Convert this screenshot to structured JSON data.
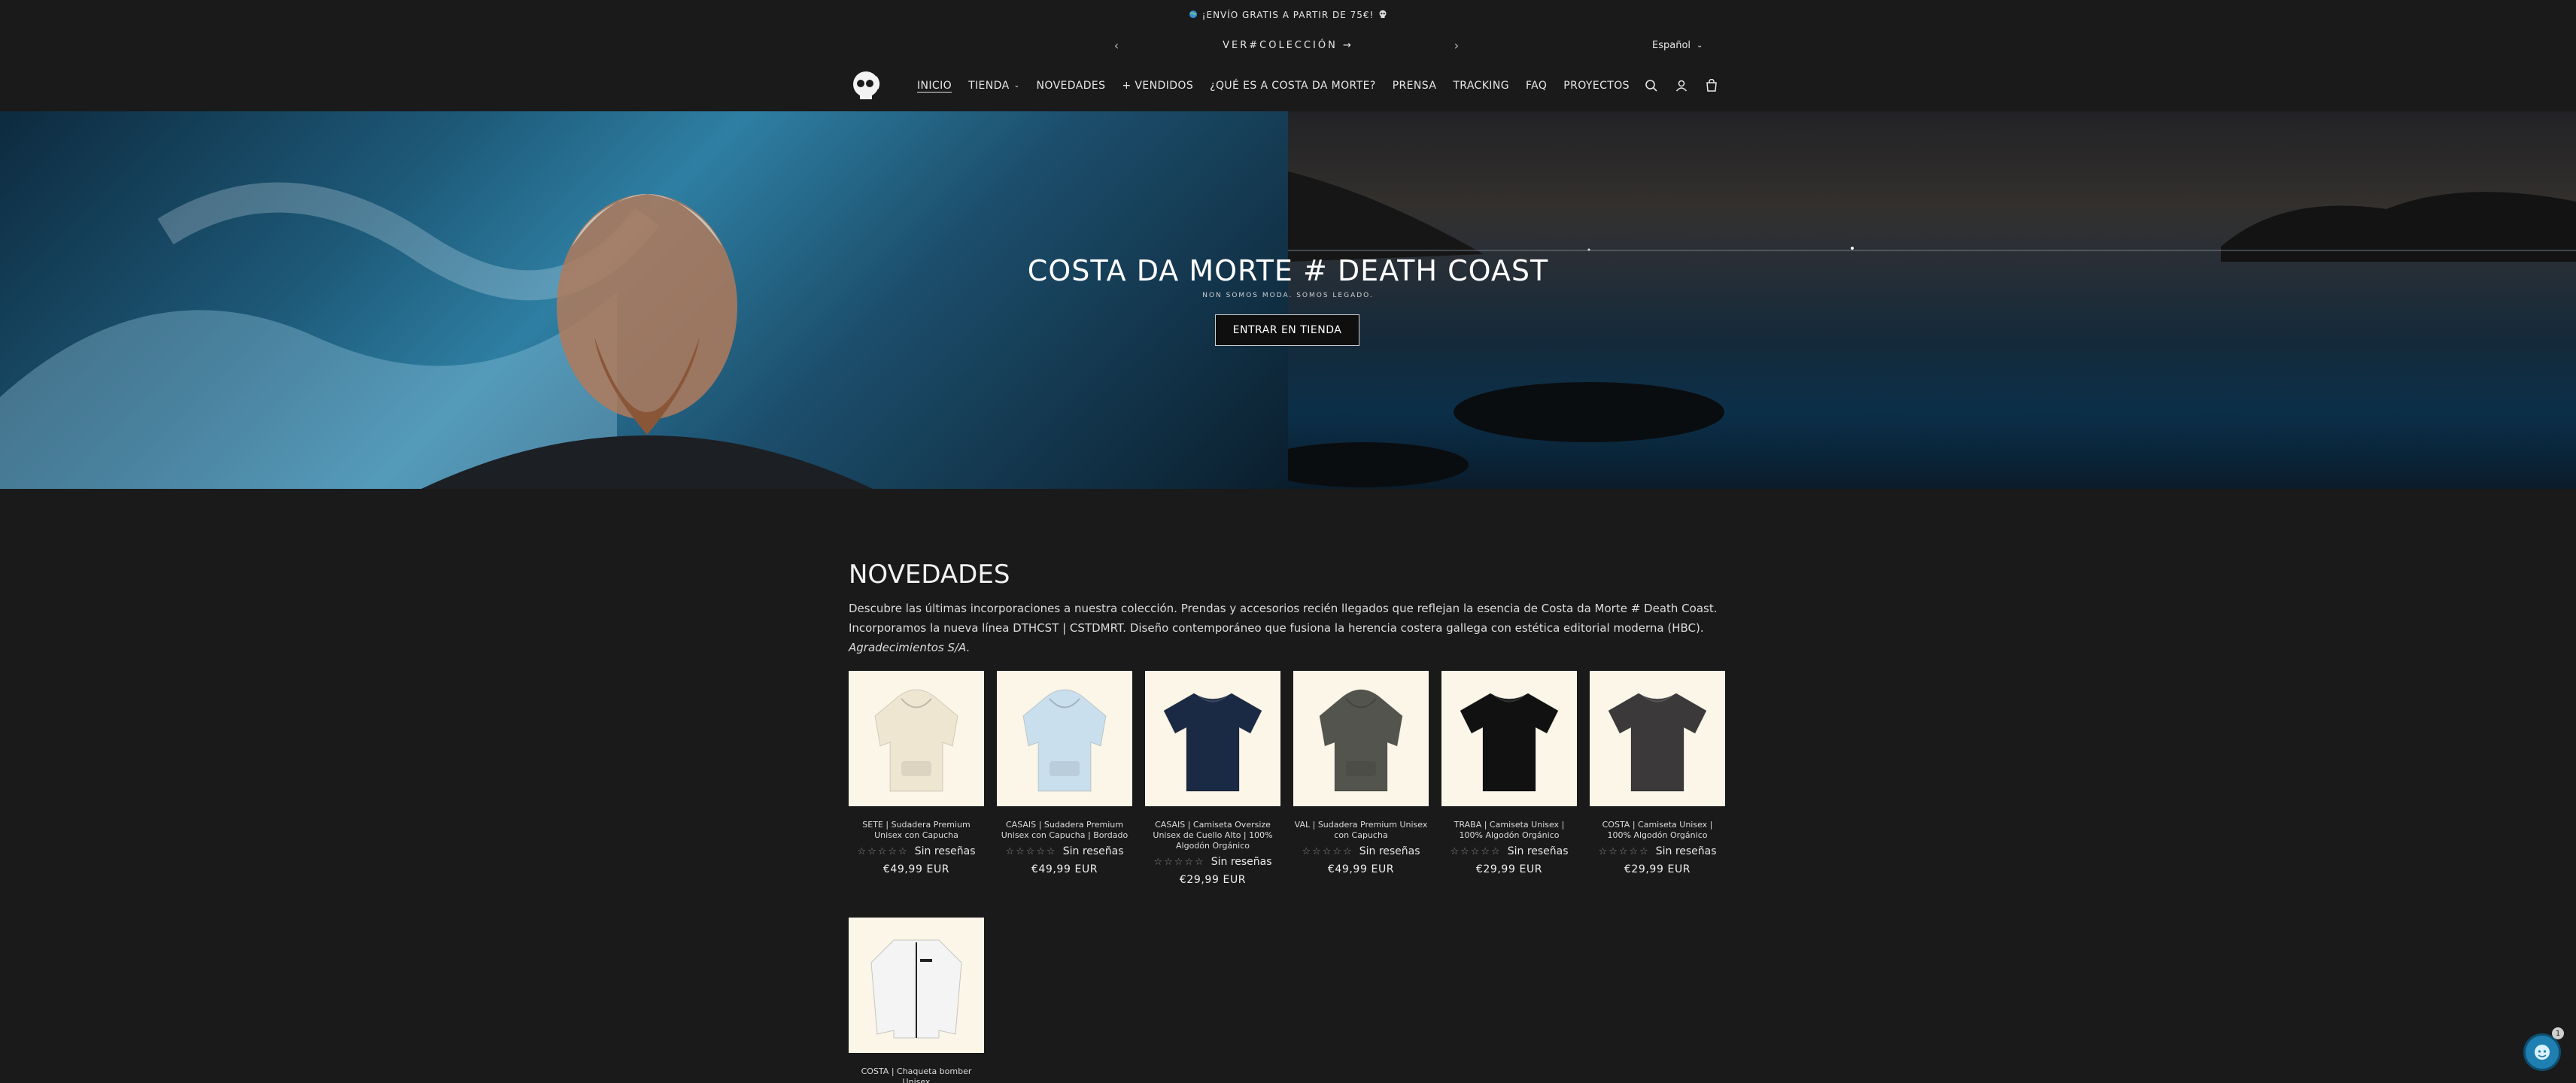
{
  "announcement": {
    "text": "¡ENVÍO GRATIS A PARTIR DE 75€!",
    "left_icon": "globe-icon",
    "right_icon": "skull-icon"
  },
  "utility": {
    "link_label": "VER#COLECCIÓN →",
    "language": "Español"
  },
  "nav": {
    "items": [
      {
        "label": "INICIO"
      },
      {
        "label": "TIENDA"
      },
      {
        "label": "NOVEDADES"
      },
      {
        "label": "+ VENDIDOS"
      },
      {
        "label": "¿QUÉ ES A COSTA DA MORTE?"
      },
      {
        "label": "PRENSA"
      },
      {
        "label": "TRACKING"
      },
      {
        "label": "FAQ"
      },
      {
        "label": "PROYECTOS"
      }
    ]
  },
  "hero": {
    "title": "COSTA DA MORTE # DEATH COAST",
    "subtitle": "NON SOMOS MODA. SOMOS LEGADO.",
    "button": "ENTRAR EN TIENDA"
  },
  "novedades": {
    "title": "NOVEDADES",
    "line1": "Descubre las últimas incorporaciones a nuestra colección. Prendas y accesorios recién llegados que reflejan la esencia de Costa da Morte # Death Coast.",
    "line2": "Incorporamos la nueva línea DTHCST | CSTDMRT. Diseño contemporáneo que fusiona la herencia costera gallega con estética editorial moderna (HBC).",
    "line3": "Agradecimientos S/A."
  },
  "products": [
    {
      "name": "SETE | Sudadera Premium Unisex con Capucha",
      "reviews": "Sin reseñas",
      "price": "€49,99 EUR",
      "color": "#efe6d2",
      "kind": "hoodie"
    },
    {
      "name": "CASAIS | Sudadera Premium Unisex con Capucha | Bordado",
      "reviews": "Sin reseñas",
      "price": "€49,99 EUR",
      "color": "#c9dfee",
      "kind": "hoodie"
    },
    {
      "name": "CASAIS | Camiseta Oversize Unisex de Cuello Alto | 100% Algodón Orgánico",
      "reviews": "Sin reseñas",
      "price": "€29,99 EUR",
      "color": "#1b2a44",
      "kind": "tee"
    },
    {
      "name": "VAL | Sudadera Premium Unisex con Capucha",
      "reviews": "Sin reseñas",
      "price": "€49,99 EUR",
      "color": "#54544f",
      "kind": "hoodie"
    },
    {
      "name": "TRABA | Camiseta Unisex | 100% Algodón Orgánico",
      "reviews": "Sin reseñas",
      "price": "€29,99 EUR",
      "color": "#111111",
      "kind": "tee"
    },
    {
      "name": "COSTA | Camiseta Unisex | 100% Algodón Orgánico",
      "reviews": "Sin reseñas",
      "price": "€29,99 EUR",
      "color": "#3b393a",
      "kind": "tee"
    },
    {
      "name": "COSTA | Chaqueta bomber Unisex",
      "reviews": "",
      "price": "",
      "color": "#f4f4f4",
      "kind": "jacket"
    }
  ],
  "chat": {
    "badge": "1"
  }
}
